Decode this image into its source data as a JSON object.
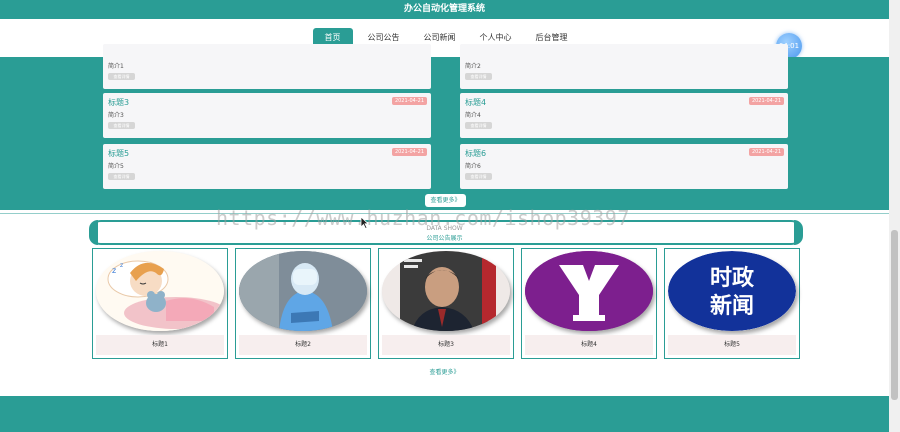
{
  "header": {
    "title": "办公自动化管理系统"
  },
  "nav": {
    "items": [
      {
        "label": "首页",
        "active": true
      },
      {
        "label": "公司公告",
        "active": false
      },
      {
        "label": "公司新闻",
        "active": false
      },
      {
        "label": "个人中心",
        "active": false
      },
      {
        "label": "后台管理",
        "active": false
      }
    ]
  },
  "clock": {
    "time": "04:01"
  },
  "news": {
    "cards": [
      {
        "title": "",
        "intro": "简介1",
        "button": "查看详情",
        "date": ""
      },
      {
        "title": "",
        "intro": "简介2",
        "button": "查看详情",
        "date": ""
      },
      {
        "title": "标题3",
        "intro": "简介3",
        "button": "查看详情",
        "date": "2021-04-21"
      },
      {
        "title": "标题4",
        "intro": "简介4",
        "button": "查看详情",
        "date": "2021-04-21"
      },
      {
        "title": "标题5",
        "intro": "简介5",
        "button": "查看详情",
        "date": "2021-04-21"
      },
      {
        "title": "标题6",
        "intro": "简介6",
        "button": "查看详情",
        "date": "2021-04-21"
      }
    ],
    "more_label": "查看更多》"
  },
  "watermark": "https://www.huzhan.com/ishop39397",
  "announcements": {
    "en_title": "DATA SHOW",
    "cn_title": "公司公告展示",
    "tiles": [
      {
        "caption": "标题1",
        "image": "cartoon-sleeping-girl"
      },
      {
        "caption": "标题2",
        "image": "medical-worker-photo"
      },
      {
        "caption": "标题3",
        "image": "magazine-cover-photo"
      },
      {
        "caption": "标题4",
        "image": "yahoo-logo"
      },
      {
        "caption": "标题5",
        "image": "political-news-logo",
        "logo_text": "时政\n新闻"
      }
    ],
    "more_label": "查看更多》"
  },
  "colors": {
    "accent": "#2a9d95",
    "date_badge": "#f3a3a3"
  }
}
